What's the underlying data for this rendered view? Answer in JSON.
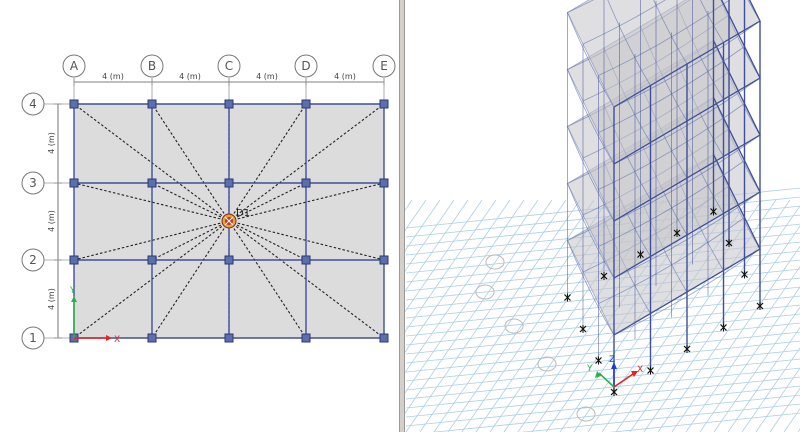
{
  "plan_view": {
    "grid_x_labels": [
      "A",
      "B",
      "C",
      "D",
      "E"
    ],
    "grid_y_labels": [
      "4",
      "3",
      "2",
      "1"
    ],
    "x_spacing_labels": [
      "4 (m)",
      "4 (m)",
      "4 (m)",
      "4 (m)"
    ],
    "y_spacing_labels": [
      "4 (m)",
      "4 (m)",
      "4 (m)"
    ],
    "point_label": "D1",
    "axis_x_label": "X",
    "axis_y_label": "Y"
  },
  "model_3d_view": {
    "axis_x_label": "X",
    "axis_y_label": "Y",
    "axis_z_label": "Z"
  },
  "colors": {
    "frame": "#3f4f9a",
    "slab": "#dcdcdc",
    "axis_x": "#e8231d",
    "axis_y": "#27b34a",
    "axis_z": "#1f3bd0",
    "ground_grid": "#aed0e6",
    "diaphragm_lines": "#222222",
    "point_marker": "#c0392b"
  }
}
